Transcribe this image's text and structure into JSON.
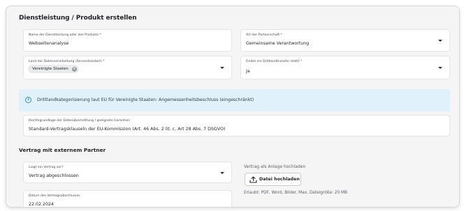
{
  "section": {
    "title": "Dienstleistung / Produkt erstellen"
  },
  "fields": {
    "service_name": {
      "label": "Name der Dienstleistung oder des Produkts *",
      "value": "Webseitenanalyse"
    },
    "partnership": {
      "label": "Art der Partnerschaft *",
      "value": "Gemeinsame Verantwortung"
    },
    "processing_country": {
      "label": "Land der Datenverarbeitung (Serverstandort) *",
      "chip": "Vereinigte Staaten"
    },
    "third_country_transfer": {
      "label": "Findet ein Drittlandtransfer statt? *",
      "value": "Ja"
    },
    "legal_basis": {
      "label": "Rechtsgrundlage der Datenübermittlung / geeignete Garantien",
      "value": "Standard-Vertragsklauseln der EU-Kommission (Art. 46 Abs. 2 lit. c, Art 28 Abs. 7 DSGVO)"
    },
    "contract_status": {
      "label": "Liegt ein Vertrag vor?",
      "value": "Vertrag abgeschlossen"
    },
    "contract_date": {
      "label": "Datum des Vertragsabschlusses",
      "value": "22.02.2024"
    }
  },
  "info_banner": {
    "text": "Drittlandkategorisierung laut EU für Vereinigte Staaten: Angemessenheitsbeschluss (eingeschränkt)",
    "icon": "info-icon",
    "color": "#e0f1fb"
  },
  "contract_section": {
    "title": "Vertrag mit externem Partner"
  },
  "upload": {
    "label": "Vertrag als Anlage hochladen",
    "button_label": "Datei hochladen",
    "hint": "Erlaubt: PDF, Word, Bilder. Max. Dateigröße: 20 MB",
    "icon": "upload-icon"
  }
}
